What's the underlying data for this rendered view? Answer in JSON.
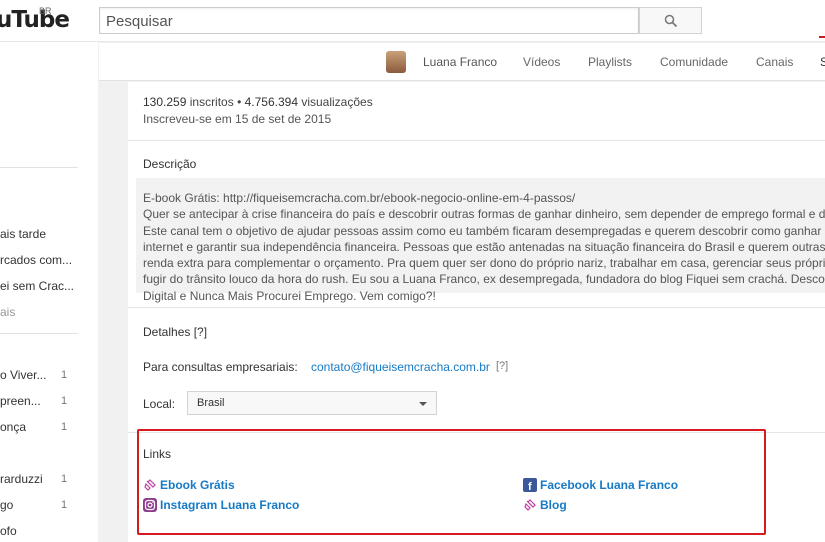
{
  "header": {
    "logo_text": "uTube",
    "logo_region": "BR",
    "search_placeholder": "Pesquisar"
  },
  "sidebar": {
    "items": [
      {
        "label": "ais tarde"
      },
      {
        "label": "rcados com..."
      },
      {
        "label": "ei sem Crac..."
      },
      {
        "label": "ais"
      }
    ],
    "subscriptions": [
      {
        "label": "o Viver...",
        "count": "1"
      },
      {
        "label": "preen...",
        "count": "1"
      },
      {
        "label": "onça",
        "count": "1"
      },
      {
        "label": "rarduzzi",
        "count": "1"
      },
      {
        "label": "go",
        "count": "1"
      },
      {
        "label": "ofo",
        "count": ""
      }
    ]
  },
  "tabs": {
    "channel_name": "Luana Franco",
    "videos": "Vídeos",
    "playlists": "Playlists",
    "community": "Comunidade",
    "channels": "Canais",
    "about_partial": "S"
  },
  "about": {
    "stats_bold": "130.259",
    "stats_rest": " inscritos • ",
    "views_bold": "4.756.394",
    "views_rest": " visualizações",
    "joined": "Inscreveu-se em 15 de set de 2015",
    "description_title": "Descrição",
    "description": "E-book Grátis: http://fiqueisemcracha.com.br/ebook-negocio-online-em-4-passos/\nQuer se antecipar à crise financeira do país e descobrir outras formas de ganhar dinheiro, sem depender de emprego formal e de\nEste canal tem o objetivo de ajudar pessoas assim como eu também ficaram desempregadas e querem descobrir como ganhar\ninternet e garantir sua independência financeira. Pessoas que estão antenadas na situação financeira do Brasil e querem outras\nrenda extra para complementar o orçamento. Pra quem quer ser dono do próprio nariz, trabalhar em casa, gerenciar seus própri\nfugir do trânsito louco da hora do rush. Eu sou a Luana Franco, ex desempregada, fundadora do blog Fiquei sem crachá. Descob\nDigital e Nunca Mais Procurei Emprego. Vem comigo?!",
    "details_title": "Detalhes [?]",
    "business_label": "Para consultas empresariais:",
    "business_email": "contato@fiqueisemcracha.com.br",
    "business_help": "[?]",
    "location_label": "Local:",
    "location_value": "Brasil"
  },
  "links": {
    "title": "Links",
    "items": [
      {
        "label": "Ebook Grátis",
        "icon": "ebook-link-icon"
      },
      {
        "label": "Facebook Luana Franco",
        "icon": "facebook-icon"
      },
      {
        "label": "Instagram Luana Franco",
        "icon": "instagram-icon"
      },
      {
        "label": "Blog",
        "icon": "blog-link-icon"
      }
    ]
  },
  "colors": {
    "link": "#167ac6",
    "highlight_border": "#d71920",
    "active_tab": "#cc181e"
  }
}
